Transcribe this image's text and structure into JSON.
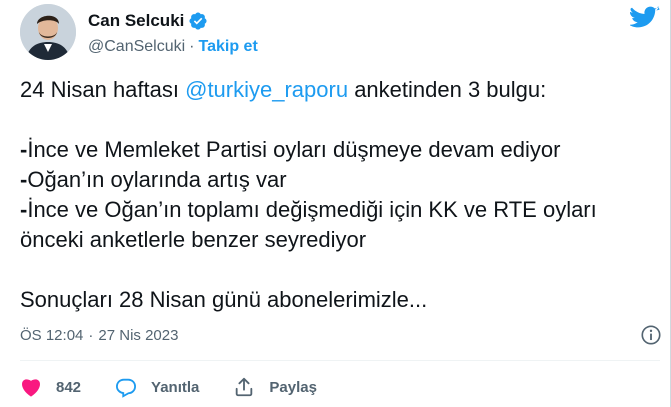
{
  "author": {
    "name": "Can Selcuki",
    "handle": "@CanSelcuki",
    "separator": "·",
    "follow_label": "Takip et"
  },
  "tweet": {
    "line1_prefix": "24 Nisan haftası ",
    "mention": "@turkiye_raporu",
    "line1_suffix": " anketinden 3 bulgu:",
    "bullet_marker": "-",
    "bullet1": "İnce ve Memleket Partisi oyları düşmeye devam ediyor",
    "bullet2": "Oğan’ın oylarında artış var",
    "bullet3_line1": "İnce ve Oğan’ın toplamı değişmediği için KK ve RTE oyları",
    "bullet3_line2": "önceki anketlerle benzer seyrediyor",
    "last_line": "Sonuçları 28 Nisan günü abonelerimizle..."
  },
  "meta": {
    "time": "ÖS 12:04",
    "separator": "·",
    "date": "27 Nis 2023"
  },
  "actions": {
    "like_count": "842",
    "reply_label": "Yanıtla",
    "share_label": "Paylaş"
  },
  "colors": {
    "accent": "#1d9bf0",
    "like": "#f91880",
    "text": "#0f1419",
    "muted": "#536471"
  },
  "icons": [
    "verified-badge-icon",
    "twitter-bird-icon",
    "info-icon",
    "heart-icon",
    "reply-icon",
    "share-icon"
  ]
}
